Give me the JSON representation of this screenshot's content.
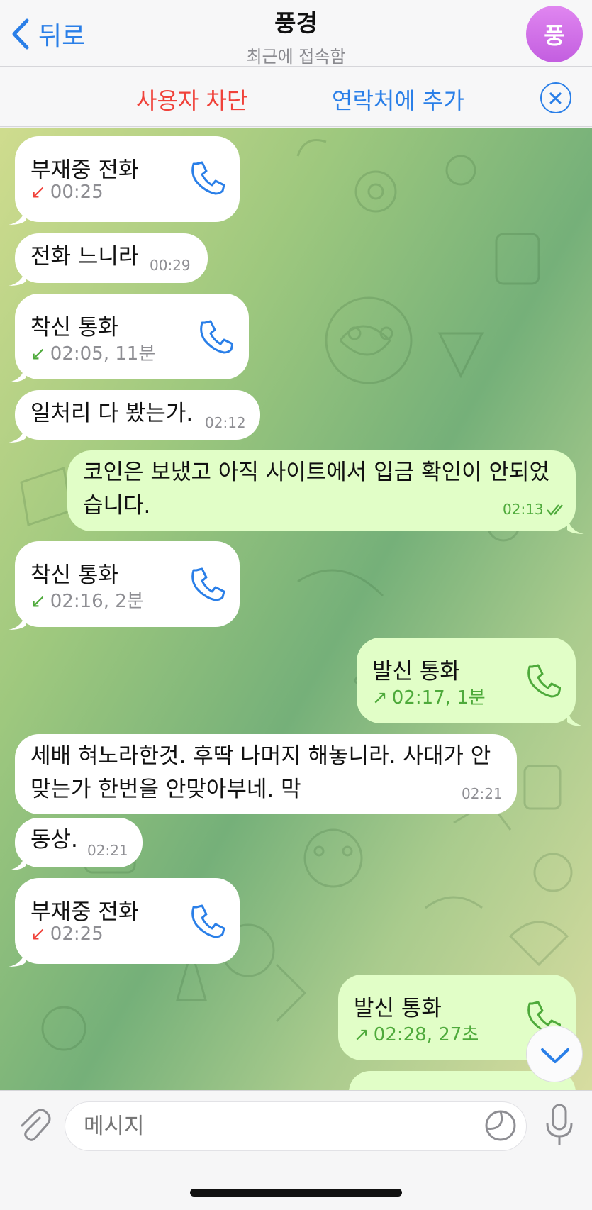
{
  "header": {
    "back_label": "뒤로",
    "title": "풍경",
    "subtitle": "최근에 접속함",
    "avatar_initial": "풍"
  },
  "actionbar": {
    "block_label": "사용자 차단",
    "add_contact_label": "연락처에 추가"
  },
  "messages": [
    {
      "type": "call",
      "direction": "in",
      "title": "부재중 전화",
      "arrow": "↙",
      "arrow_color": "red",
      "meta": "00:25"
    },
    {
      "type": "text",
      "direction": "in",
      "text": "전화 느니라",
      "time": "00:29"
    },
    {
      "type": "call",
      "direction": "in",
      "title": "착신 통화",
      "arrow": "↙",
      "arrow_color": "green",
      "meta": "02:05, 11분"
    },
    {
      "type": "text",
      "direction": "in",
      "text": "일처리 다 봤는가.",
      "time": "02:12"
    },
    {
      "type": "text",
      "direction": "out",
      "line1": "코인은 보냈고 아직 사이트에서 입금 확인이 안되었",
      "line2": "습니다.",
      "time": "02:13"
    },
    {
      "type": "call",
      "direction": "in",
      "title": "착신 통화",
      "arrow": "↙",
      "arrow_color": "green",
      "meta": "02:16, 2분"
    },
    {
      "type": "call",
      "direction": "out",
      "title": "발신 통화",
      "arrow": "↗",
      "arrow_color": "green",
      "meta": "02:17, 1분"
    },
    {
      "type": "text",
      "direction": "in",
      "line1": "세배 혀노라한것. 후딱 나머지 해놓니라. 사대가 안",
      "line2": "맞는가 한번을 안맞아부네. 막",
      "time": "02:21"
    },
    {
      "type": "text",
      "direction": "in",
      "text": "동상.",
      "time": "02:21"
    },
    {
      "type": "call",
      "direction": "in",
      "title": "부재중 전화",
      "arrow": "↙",
      "arrow_color": "red",
      "meta": "02:25"
    },
    {
      "type": "call",
      "direction": "out",
      "title": "발신 통화",
      "arrow": "↗",
      "arrow_color": "green",
      "meta": "02:28, 27초"
    }
  ],
  "input": {
    "placeholder": "메시지"
  },
  "colors": {
    "accent": "#2a7fe8",
    "danger": "#f0423a",
    "outgoing_bubble": "#e1fec7",
    "incoming_bubble": "#ffffff",
    "read_check": "#4eaa3b"
  }
}
